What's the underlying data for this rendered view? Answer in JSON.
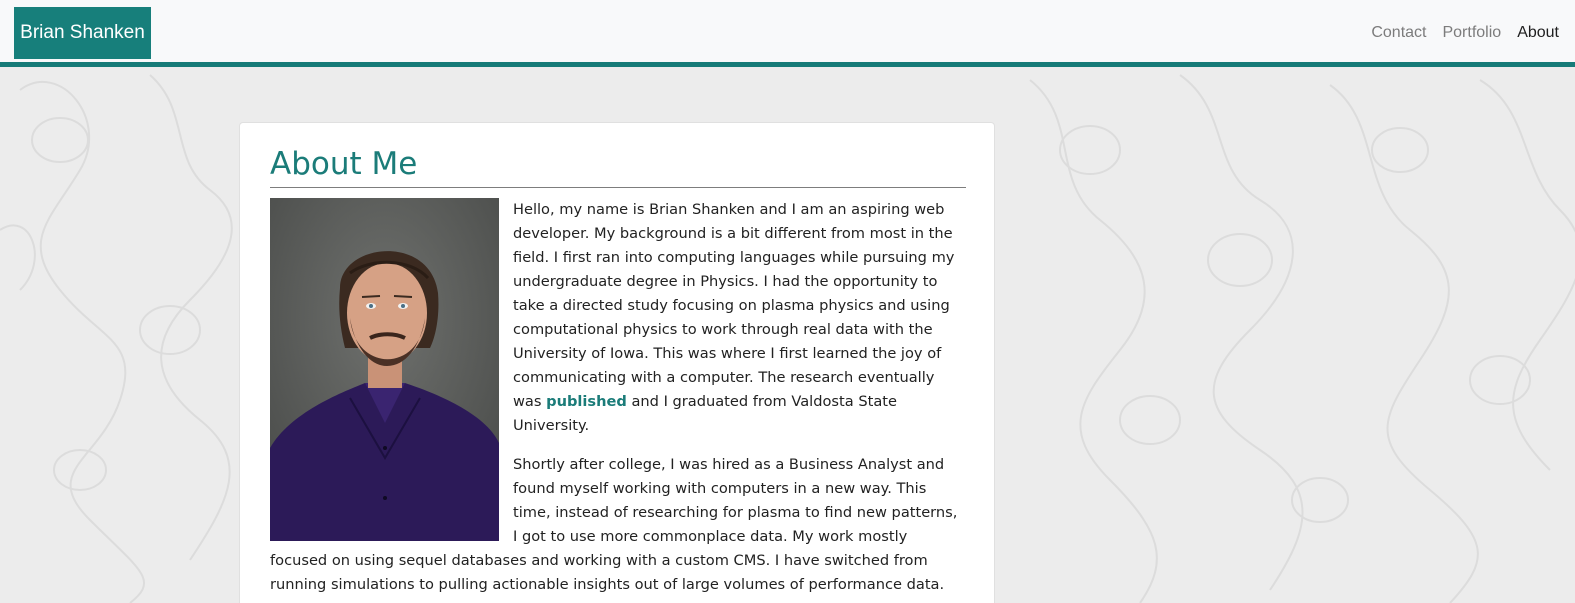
{
  "navbar": {
    "brand": "Brian Shanken",
    "links": [
      {
        "label": "Contact"
      },
      {
        "label": "Portfolio"
      },
      {
        "label": "About"
      }
    ]
  },
  "about": {
    "title": "About Me",
    "paragraph1_before": "Hello, my name is Brian Shanken and I am an aspiring web developer. My background is a bit different from most in the field. I first ran into computing languages while pursuing my undergraduate degree in Physics. I had the opportunity to take a directed study focusing on plasma physics and using computational physics to work through real data with the University of Iowa. This was where I first learned the joy of communicating with a computer. The research eventually was ",
    "paragraph1_link": "published",
    "paragraph1_after": " and I graduated from Valdosta State University.",
    "paragraph2": "Shortly after college, I was hired as a Business Analyst and found myself working with computers in a new way. This time, instead of researching for plasma to find new patterns, I got to use more commonplace data. My work mostly focused on using sequel databases and working with a custom CMS. I have switched from running simulations to pulling actionable insights out of large volumes of performance data."
  },
  "colors": {
    "accent": "#177f7b",
    "background": "#ececec",
    "navbar_bg": "#f8f9fa"
  }
}
